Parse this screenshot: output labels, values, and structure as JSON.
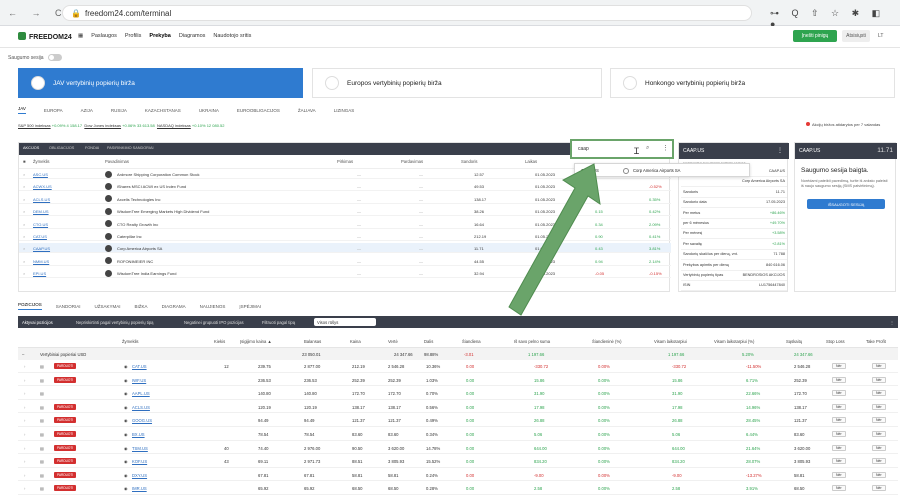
{
  "browser": {
    "url": "freedom24.com/terminal",
    "nav_icons": "← → C",
    "right_icons": "⊶ Q ⇧ ☆ ✱ ◧ ●"
  },
  "header": {
    "logo": "FREEDOM24",
    "nav": [
      "Paslaugos",
      "Profilis",
      "Prekyba",
      "Diagramos",
      "Naudotojo sritis"
    ],
    "active_nav": "Prekyba",
    "primary_button": "Įnešti pinigų",
    "secondary_button": "Atsisiųsti",
    "lang": "LT"
  },
  "safe_session": {
    "label": "Saugumo sesija"
  },
  "markets": [
    {
      "label": "JAV vertybinių popierių birža"
    },
    {
      "label": "Europos vertybinių popierių birža"
    },
    {
      "label": "Honkongo vertybinių popierių birža"
    }
  ],
  "regions": [
    "JAV",
    "EUROPA",
    "AZIJA",
    "RUSIJA",
    "KAZACHSTANAS",
    "UKRAINA",
    "EUROOBLIGACIJOS",
    "ŽALIAVA",
    "LIZINGAS"
  ],
  "active_region": "JAV",
  "indices": {
    "i1": "S&P 500 indeksas",
    "v1": "+0.09% 4 158.17",
    "i2": "Dow Jones indeksas",
    "v2": "+0.06% 33 613.58",
    "i3": "NASDAQ indeksas",
    "v3": "+0.10% 12 080.52"
  },
  "market_status": "Akcijų biržos atidarytos per 7 valandas",
  "watchlist": {
    "tabs": [
      "AKCIJOS",
      "OBLIGACIJOS",
      "FONDAI",
      "PASIRINKIMO SANDORIAI"
    ],
    "headers": [
      "Žymeklis",
      "Pavadinimas",
      "Pirkimas",
      "Pardavimas",
      "Sandoris",
      "Laikas"
    ],
    "rows": [
      {
        "ticker": "ASC.US",
        "name": "Ardmore Shipping Corporation Common Stock",
        "d1": "—",
        "d2": "—",
        "price": "12.57",
        "date": "01.05.2023",
        "chg": "",
        "pct": "1.78%",
        "cls": "pos"
      },
      {
        "ticker": "ACWX.US",
        "name": "iShares MSCI ACWI ex US Index Fund",
        "d1": "—",
        "d2": "—",
        "price": "49.53",
        "date": "01.05.2023",
        "chg": "",
        "pct": "-0.52%",
        "cls": "neg"
      },
      {
        "ticker": "ACLS.US",
        "name": "Axcelis Technologies Inc",
        "d1": "—",
        "d2": "—",
        "price": "138.17",
        "date": "01.05.2023",
        "chg": "",
        "pct": "0.35%",
        "cls": "pos"
      },
      {
        "ticker": "DEM.US",
        "name": "WisdomTree Emerging Markets High Dividend Fund",
        "d1": "—",
        "d2": "—",
        "price": "38.26",
        "date": "01.05.2023",
        "chg": "0.15",
        "pct": "0.42%",
        "cls": "pos"
      },
      {
        "ticker": "CTO.US",
        "name": "CTO Realty Growth Inc",
        "d1": "—",
        "d2": "—",
        "price": "16.64",
        "date": "01.05.2023",
        "chg": "0.34",
        "pct": "2.09%",
        "cls": "pos"
      },
      {
        "ticker": "CAT.US",
        "name": "Caterpillar Inc",
        "d1": "—",
        "d2": "—",
        "price": "212.19",
        "date": "01.05.2023",
        "chg": "0.90",
        "pct": "0.41%",
        "cls": "pos"
      },
      {
        "ticker": "CAAP.US",
        "name": "Corp America Airports SA",
        "d1": "—",
        "d2": "—",
        "price": "11.71",
        "date": "01.05.2023",
        "chg": "0.43",
        "pct": "3.81%",
        "cls": "pos"
      },
      {
        "ticker": "NMM.US",
        "name": "ROFONIMEIER INC",
        "d1": "—",
        "d2": "—",
        "price": "44.55",
        "date": "01.05.2023",
        "chg": "0.94",
        "pct": "2.14%",
        "cls": "pos"
      },
      {
        "ticker": "EPI.US",
        "name": "WisdomTree India Earnings Fund",
        "d1": "—",
        "d2": "—",
        "price": "32.94",
        "date": "01.05.2023",
        "chg": "-0.05",
        "pct": "-0.15%",
        "cls": "neg"
      }
    ]
  },
  "search": {
    "value": "caap",
    "result_ticker": "CAAP.US",
    "result_name": "Corp America Airports SA",
    "result_flag": "Corp"
  },
  "quote": {
    "title": "CAAP.US",
    "tabs": "KOTIRAVIMAI   NAUJIENOS   SUBKRILAIVINAS",
    "rows": [
      {
        "k": "",
        "v": "CAAP.US"
      },
      {
        "k": "",
        "v": "Corp America Airports SA"
      },
      {
        "k": "Sandoris",
        "v": "11.71"
      },
      {
        "k": "Sandorio data",
        "v": "17.05.2023"
      },
      {
        "k": "Per metus",
        "v": "+86.46%"
      },
      {
        "k": "per 6 mėnesius",
        "v": "+49.70%"
      },
      {
        "k": "Per mėnesį",
        "v": "+3.58%"
      },
      {
        "k": "Per savaitę",
        "v": "+2.81%"
      },
      {
        "k": "Sandorių skaičius per dieną, vnt.",
        "v": "71 788"
      },
      {
        "k": "Prekybos apimtis per dieną",
        "v": "840 616.06"
      },
      {
        "k": "Vertybinių popierių tipas",
        "v": "BENDROSIOS AKCIJOS"
      },
      {
        "k": "ISIN",
        "v": "LU1756447840"
      }
    ]
  },
  "safety": {
    "bar_label": "CAAP.US",
    "bar_value": "11.71",
    "title": "Saugumo sesija baigta.",
    "text": "Norėdami pateikti pavedimą, turite iš anksto paleisti iš naujo saugumo sesiją (SMS patvirtinimą).",
    "button": "IŠSAUGOTI SESIJĄ"
  },
  "lower_tabs": [
    "POZICIJOS",
    "SANDORIAI",
    "UŽSAKYMAI",
    "BIŽKA",
    "DIAGRAMA",
    "NAUJIENOS",
    "ĮSPĖJIMAI"
  ],
  "portfolio": {
    "bar": [
      "Aktyvai pozicijos",
      "Nepriskirtinti pagal vertybinių popierių tipą",
      "Negatinei grupuoti IPO pozicijas",
      "Filtruoti pagal tipą"
    ],
    "filter_value": "Visos rūšys",
    "headers": [
      "Žymeklis",
      "Kiekis",
      "Įsigijimo kaina ▲",
      "Balansas",
      "Kaina",
      "Vertė",
      "Dalis",
      "Šiandiena",
      "Iš savo pelno suma",
      "Šiandieninė (%)",
      "Visam laikotarpiui",
      "Visam laikotarpiui (%)",
      "Sąskaitų",
      "Stop Loss",
      "Take Profit"
    ],
    "group": {
      "label": "Vertybiniai popieriai USD",
      "balance": "23 050.01",
      "value": "24 347.66",
      "share": "98.88%",
      "today": "-3.01",
      "pnl": "1 197.66",
      "tpnl": "1 197.66",
      "tpct": "5.20%",
      "acct": "24 347.66"
    },
    "rows": [
      {
        "badge": "PARDUOTI",
        "ticker": "CAT.US",
        "qty": "12",
        "cost": "239.75",
        "bal": "2 877.00",
        "price": "212.19",
        "val": "2 546.28",
        "share": "10.36%",
        "today": "0.00",
        "pnl": "-330.72",
        "tp": "0.00%",
        "all": "-330.72",
        "allp": "-11.50%",
        "acct": "2 546.28",
        "cls": "neg"
      },
      {
        "badge": "PARDUOTI",
        "ticker": "IWF.US",
        "qty": "",
        "cost": "236.53",
        "bal": "236.53",
        "price": "252.39",
        "val": "252.39",
        "share": "1.03%",
        "today": "0.00",
        "pnl": "15.86",
        "tp": "0.00%",
        "all": "15.86",
        "allp": "6.71%",
        "acct": "252.39",
        "cls": "pos"
      },
      {
        "badge": "",
        "ticker": "AAPL.US",
        "qty": "",
        "cost": "140.80",
        "bal": "140.80",
        "price": "172.70",
        "val": "172.70",
        "share": "0.70%",
        "today": "0.00",
        "pnl": "31.90",
        "tp": "0.00%",
        "all": "31.90",
        "allp": "22.66%",
        "acct": "172.70",
        "cls": "pos"
      },
      {
        "badge": "PARDUOTI",
        "ticker": "ACLS.US",
        "qty": "",
        "cost": "120.19",
        "bal": "120.19",
        "price": "138.17",
        "val": "138.17",
        "share": "0.56%",
        "today": "0.00",
        "pnl": "17.98",
        "tp": "0.00%",
        "all": "17.98",
        "allp": "14.96%",
        "acct": "138.17",
        "cls": "pos"
      },
      {
        "badge": "PARDUOTI",
        "ticker": "GOOG.US",
        "qty": "",
        "cost": "94.49",
        "bal": "94.49",
        "price": "121.37",
        "val": "121.37",
        "share": "0.49%",
        "today": "0.00",
        "pnl": "26.88",
        "tp": "0.00%",
        "all": "26.88",
        "allp": "28.45%",
        "acct": "121.37",
        "cls": "pos"
      },
      {
        "badge": "PARDUOTI",
        "ticker": "BX.US",
        "qty": "",
        "cost": "78.54",
        "bal": "78.54",
        "price": "83.60",
        "val": "83.60",
        "share": "0.34%",
        "today": "0.00",
        "pnl": "5.06",
        "tp": "0.00%",
        "all": "5.06",
        "allp": "6.44%",
        "acct": "83.60",
        "cls": "pos"
      },
      {
        "badge": "PARDUOTI",
        "ticker": "TSM.US",
        "qty": "40",
        "cost": "74.40",
        "bal": "2 976.00",
        "price": "90.50",
        "val": "3 620.00",
        "share": "14.78%",
        "today": "0.00",
        "pnl": "644.00",
        "tp": "0.00%",
        "all": "644.00",
        "allp": "21.64%",
        "acct": "3 620.00",
        "cls": "pos"
      },
      {
        "badge": "PARDUOTI",
        "ticker": "KOF.US",
        "qty": "43",
        "cost": "69.11",
        "bal": "2 971.73",
        "price": "88.51",
        "val": "3 805.93",
        "share": "15.52%",
        "today": "0.00",
        "pnl": "834.20",
        "tp": "0.00%",
        "all": "834.20",
        "allp": "28.07%",
        "acct": "3 805.93",
        "cls": "pos"
      },
      {
        "badge": "PARDUOTI",
        "ticker": "DXY.US",
        "qty": "",
        "cost": "67.81",
        "bal": "67.81",
        "price": "58.81",
        "val": "58.81",
        "share": "0.24%",
        "today": "0.00",
        "pnl": "-9.00",
        "tp": "0.00%",
        "all": "-9.00",
        "allp": "-13.27%",
        "acct": "58.81",
        "cls": "neg"
      },
      {
        "badge": "PARDUOTI",
        "ticker": "IMR.US",
        "qty": "",
        "cost": "65.92",
        "bal": "65.92",
        "price": "68.50",
        "val": "68.50",
        "share": "0.28%",
        "today": "0.00",
        "pnl": "2.58",
        "tp": "0.00%",
        "all": "2.58",
        "allp": "3.91%",
        "acct": "68.50",
        "cls": "pos"
      }
    ],
    "nil": "Nėr"
  },
  "colors": {
    "accent": "#2f7bd0",
    "dark_bar": "#3a3f4b",
    "green": "#2ea44f",
    "red": "#d32f2f",
    "annotation": "#6aa46a"
  }
}
